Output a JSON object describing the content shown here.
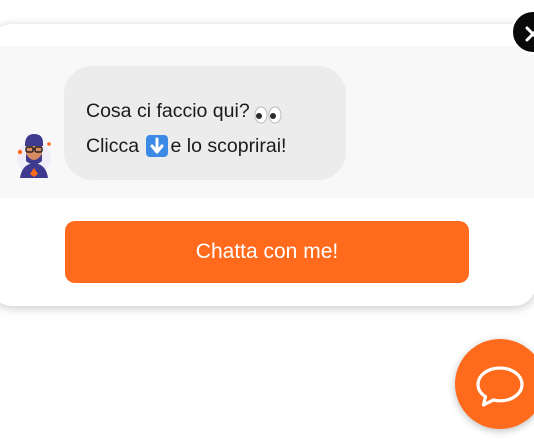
{
  "chat_widget": {
    "message_line_1": "Cosa ci faccio qui?",
    "message_line_1_emoji": "eyes",
    "message_line_2_start": "Clicca",
    "message_line_2_emoji": "down-arrow",
    "message_line_2_end": "e lo scoprirai!",
    "cta_label": "Chatta con me!",
    "close_icon": "close-icon",
    "launcher_icon": "chat-bubble-icon",
    "avatar_icon": "bot-avatar"
  },
  "colors": {
    "accent": "#ff6a1c",
    "bubble": "#ececec",
    "close_button": "#0a0a0a"
  }
}
